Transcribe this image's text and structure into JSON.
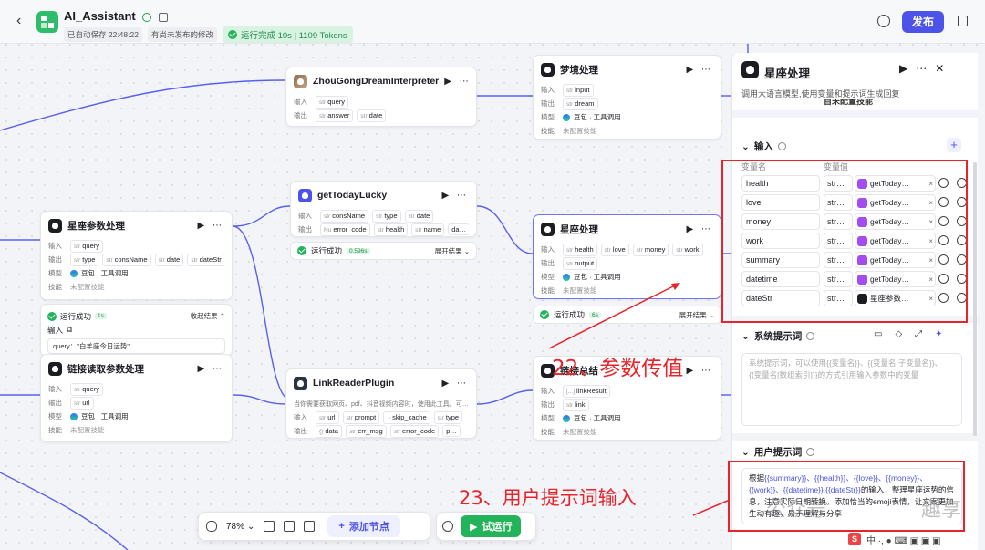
{
  "header": {
    "app_name": "AI_Assistant",
    "autosave": "已自动保存 22:48:22",
    "unpublished": "有尚未发布的修改",
    "run_status": "运行完成 10s | 1109 Tokens",
    "publish_label": "发布"
  },
  "labels": {
    "input": "输入",
    "output": "输出",
    "model": "模型",
    "skill": "技能",
    "unconfigured": "未配置技能",
    "model_name": "豆包 · 工具调用"
  },
  "nodes": {
    "zhougong": {
      "title": "ZhouGongDreamInterpreter",
      "inputs": [
        "query"
      ],
      "outputs": [
        "answer",
        "date"
      ]
    },
    "dream": {
      "title": "梦境处理",
      "inputs": [
        "input"
      ],
      "outputs": [
        "dream"
      ]
    },
    "lucky": {
      "title": "getTodayLucky",
      "inputs": [
        "consName",
        "type",
        "date"
      ],
      "outputs": [
        "error_code",
        "health",
        "name",
        "da…"
      ],
      "result": "运行成功",
      "time": "0.596s",
      "expand": "展开结果"
    },
    "param": {
      "title": "星座参数处理",
      "inputs": [
        "query"
      ],
      "outputs": [
        "type",
        "consName",
        "date",
        "dateStr"
      ],
      "result": "运行成功",
      "time": "1s",
      "collapse": "收起结果",
      "result_input_label": "输入",
      "result_query": "query：\"白羊座今日运势\""
    },
    "horoscope": {
      "title": "星座处理",
      "inputs": [
        "health",
        "love",
        "money",
        "work"
      ],
      "outputs": [
        "output"
      ],
      "result": "运行成功",
      "time": "6s",
      "expand": "展开结果"
    },
    "linkparam": {
      "title": "链接读取参数处理",
      "inputs": [
        "query"
      ],
      "outputs": [
        "url"
      ]
    },
    "reader": {
      "title": "LinkReaderPlugin",
      "desc": "当你需要获取网页、pdf、抖音视频内容时，使用此工具。可…",
      "inputs": [
        "url",
        "prompt",
        "skip_cache",
        "type"
      ],
      "outputs": [
        "data",
        "err_msg",
        "error_code",
        "p…"
      ]
    },
    "linksum": {
      "title": "链接总结",
      "inputs": [
        "linkResult"
      ],
      "outputs": [
        "link"
      ]
    }
  },
  "toolbar": {
    "zoom": "78%",
    "add_node": "添加节点",
    "run": "试运行"
  },
  "panel": {
    "title": "星座处理",
    "desc": "调用大语言模型,使用变量和提示词生成回复",
    "cut_text": "自未配置技能",
    "input_section": "输入",
    "col_name": "变量名",
    "col_value": "变量值",
    "variables": [
      {
        "name": "health",
        "type": "str…",
        "ref": "getToday…"
      },
      {
        "name": "love",
        "type": "str…",
        "ref": "getToday…"
      },
      {
        "name": "money",
        "type": "str…",
        "ref": "getToday…"
      },
      {
        "name": "work",
        "type": "str…",
        "ref": "getToday…"
      },
      {
        "name": "summary",
        "type": "str…",
        "ref": "getToday…"
      },
      {
        "name": "datetime",
        "type": "str…",
        "ref": "getToday…"
      },
      {
        "name": "dateStr",
        "type": "str…",
        "ref": "星座参数…"
      }
    ],
    "system_section": "系统提示词",
    "system_placeholder": "系统提示词，可以使用{{变量名}}、{{变量名.子变量名}}、{{变量名[数组索引]}}的方式引用输入参数中的变量",
    "user_section": "用户提示词",
    "user_prompt_pre": "根据",
    "user_prompt_vars": "{{summary}}、{{health}}、{{love}}、{{money}}、{{work}}、{{datetime}},{{dateStr}}",
    "user_prompt_post": "的输入，整理星座运势的信息，注意实际日期转换。添加恰当的emoji表情，让文案更加生动有趣，易于理解与分享"
  },
  "annotations": {
    "step22": "22、参数传值",
    "step23": "23、用户提示词输入"
  },
  "watermark": {
    "left": "公众号",
    "right": "趣享"
  },
  "colors": {
    "accent": "#4d53e8",
    "success": "#23b35b",
    "annotation": "#e8242b"
  }
}
